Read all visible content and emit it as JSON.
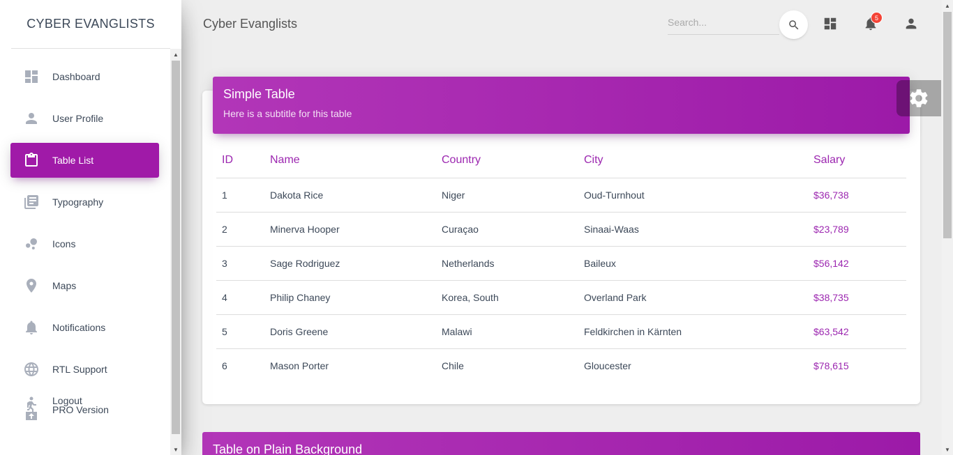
{
  "brand": "CYBER EVANGLISTS",
  "sidebar": {
    "items": [
      {
        "label": "Dashboard",
        "icon": "dashboard-icon"
      },
      {
        "label": "User Profile",
        "icon": "person-icon"
      },
      {
        "label": "Table List",
        "icon": "clipboard-icon",
        "active": true
      },
      {
        "label": "Typography",
        "icon": "library-books-icon"
      },
      {
        "label": "Icons",
        "icon": "bubble-chart-icon"
      },
      {
        "label": "Maps",
        "icon": "location-pin-icon"
      },
      {
        "label": "Notifications",
        "icon": "bell-icon"
      },
      {
        "label": "RTL Support",
        "icon": "language-icon"
      }
    ],
    "logout": {
      "label": "Logout",
      "sub_label": "PRO Version",
      "icon": "logout-icon"
    }
  },
  "header": {
    "title": "Cyber Evanglists",
    "search_placeholder": "Search...",
    "notification_count": "5"
  },
  "card": {
    "title": "Simple Table",
    "subtitle": "Here is a subtitle for this table",
    "columns": [
      "ID",
      "Name",
      "Country",
      "City",
      "Salary"
    ],
    "rows": [
      [
        "1",
        "Dakota Rice",
        "Niger",
        "Oud-Turnhout",
        "$36,738"
      ],
      [
        "2",
        "Minerva Hooper",
        "Curaçao",
        "Sinaai-Waas",
        "$23,789"
      ],
      [
        "3",
        "Sage Rodriguez",
        "Netherlands",
        "Baileux",
        "$56,142"
      ],
      [
        "4",
        "Philip Chaney",
        "Korea, South",
        "Overland Park",
        "$38,735"
      ],
      [
        "5",
        "Doris Greene",
        "Malawi",
        "Feldkirchen in Kärnten",
        "$63,542"
      ],
      [
        "6",
        "Mason Porter",
        "Chile",
        "Gloucester",
        "$78,615"
      ]
    ]
  },
  "card2": {
    "title": "Table on Plain Background"
  },
  "colors": {
    "accent": "#9c27b0",
    "badge": "#f44336"
  }
}
